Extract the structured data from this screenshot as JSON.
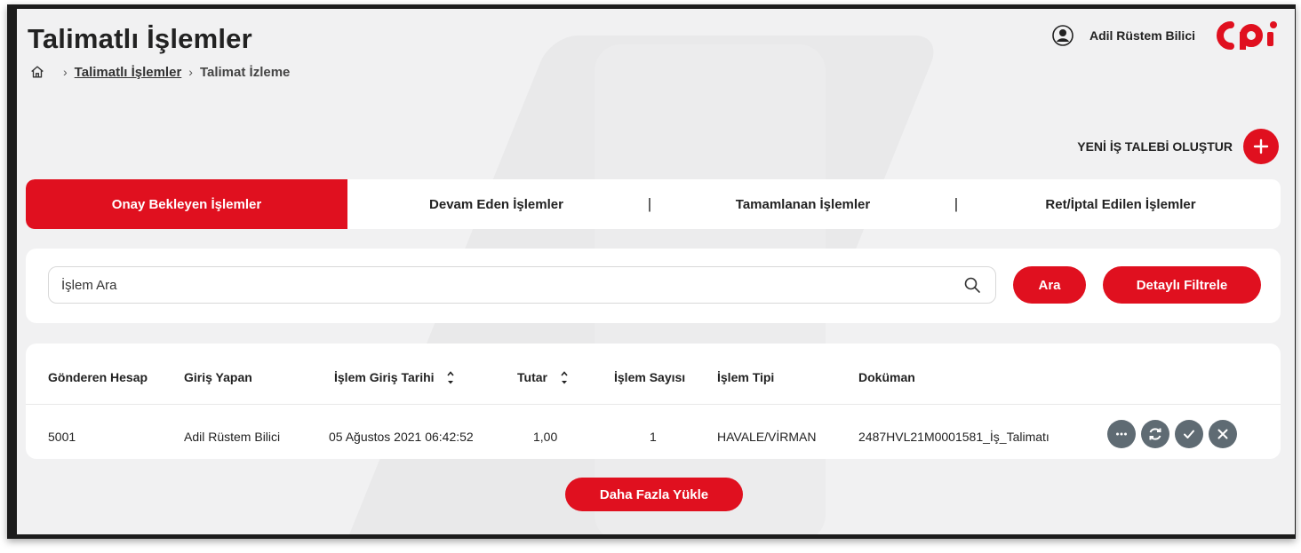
{
  "header": {
    "title": "Talimatlı İşlemler",
    "user_name": "Adil Rüstem Bilici",
    "logo_text": "cpi"
  },
  "breadcrumb": {
    "home_icon": "home-icon",
    "items": [
      "Talimatlı İşlemler",
      "Talimat İzleme"
    ]
  },
  "actions": {
    "new_request_label": "YENİ İŞ TALEBİ OLUŞTUR"
  },
  "tabs": [
    {
      "label": "Onay Bekleyen İşlemler",
      "active": true
    },
    {
      "label": "Devam Eden İşlemler",
      "active": false
    },
    {
      "label": "Tamamlanan İşlemler",
      "active": false
    },
    {
      "label": "Ret/İptal Edilen İşlemler",
      "active": false
    }
  ],
  "search": {
    "placeholder": "İşlem Ara",
    "search_button": "Ara",
    "filter_button": "Detaylı Filtrele"
  },
  "table": {
    "columns": [
      "Gönderen Hesap",
      "Giriş Yapan",
      "İşlem Giriş Tarihi",
      "Tutar",
      "İşlem Sayısı",
      "İşlem Tipi",
      "Doküman"
    ],
    "rows": [
      [
        "5001",
        "Adil Rüstem Bilici",
        "05 Ağustos 2021 06:42:52",
        "1,00",
        "1",
        "HAVALE/VİRMAN",
        "2487HVL21M0001581_İş_Talimatı"
      ]
    ],
    "row_actions": [
      "more-icon",
      "refresh-icon",
      "check-icon",
      "close-icon"
    ]
  },
  "load_more": "Daha Fazla Yükle",
  "colors": {
    "accent": "#e0101f",
    "action_button": "#5f6b73",
    "background": "#f1f1f2"
  }
}
